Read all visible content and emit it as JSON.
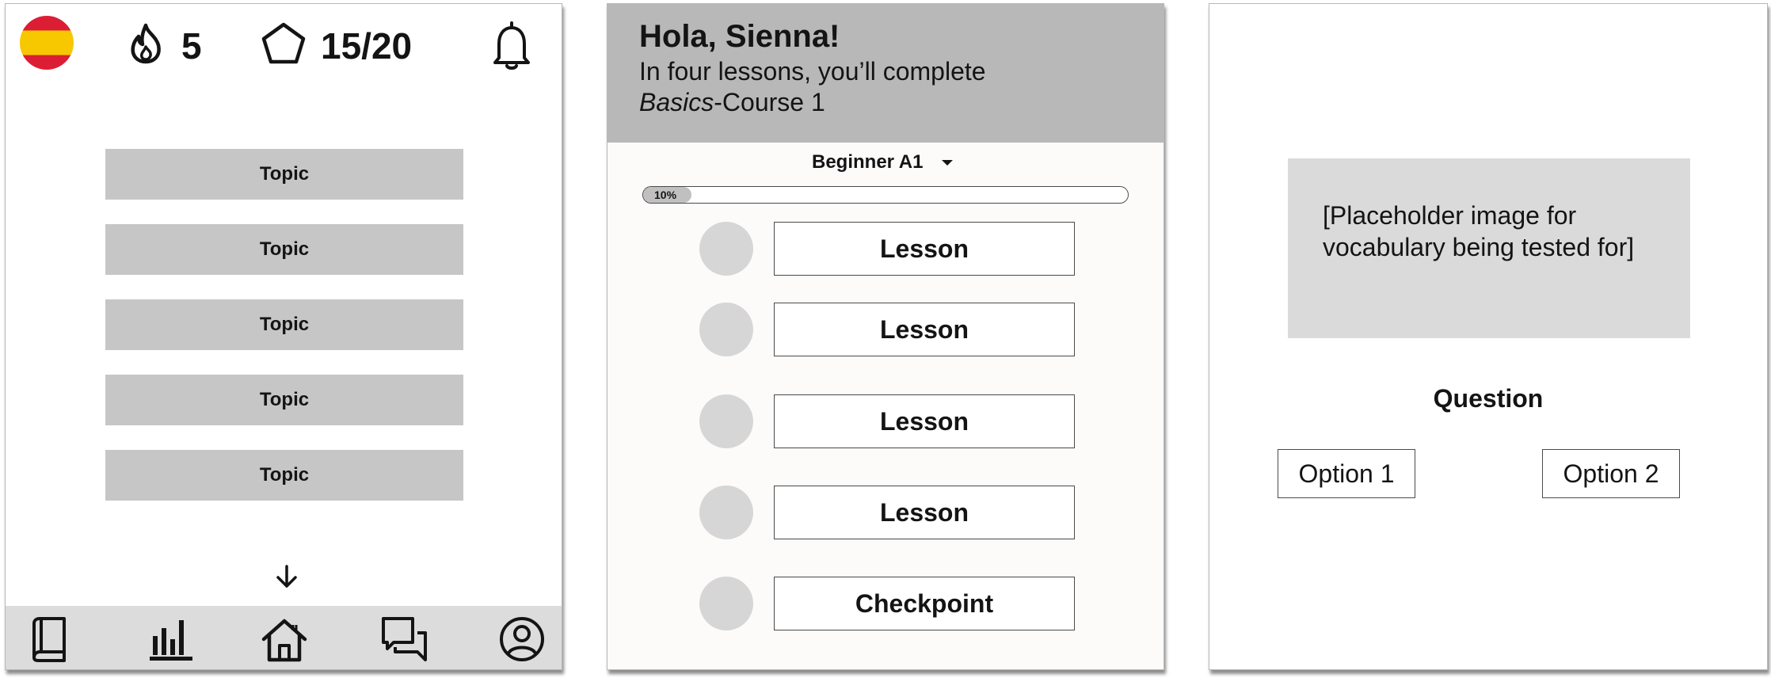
{
  "home": {
    "streak": {
      "icon": "flame-icon",
      "count": "5"
    },
    "gems": {
      "icon": "pentagon-icon",
      "count": "15/20"
    },
    "flag": "spain-flag-icon",
    "topics": [
      "Topic",
      "Topic",
      "Topic",
      "Topic",
      "Topic"
    ],
    "tabs": [
      "book-icon",
      "bar-chart-icon",
      "home-icon",
      "chat-icon",
      "profile-icon"
    ]
  },
  "course": {
    "greeting": "Hola, Sienna!",
    "intro_line": "In four lessons, you’ll complete",
    "course_name": "Basics",
    "course_suffix": "-Course 1",
    "level": "Beginner A1",
    "progress_label": "10%",
    "progress": 0.1,
    "lessons": [
      "Lesson",
      "Lesson",
      "Lesson",
      "Lesson",
      "Checkpoint"
    ]
  },
  "quiz": {
    "image_placeholder": "[Placeholder image for vocabulary being tested for]",
    "question": "Question",
    "option1": "Option 1",
    "option2": "Option 2"
  },
  "colors": {
    "topic_bg": "#c6c6c6",
    "header_bg": "#b8b8b8",
    "tabbar_bg": "#dcdcdc",
    "flag_red": "#dc1e35",
    "flag_yellow": "#f7c700"
  }
}
